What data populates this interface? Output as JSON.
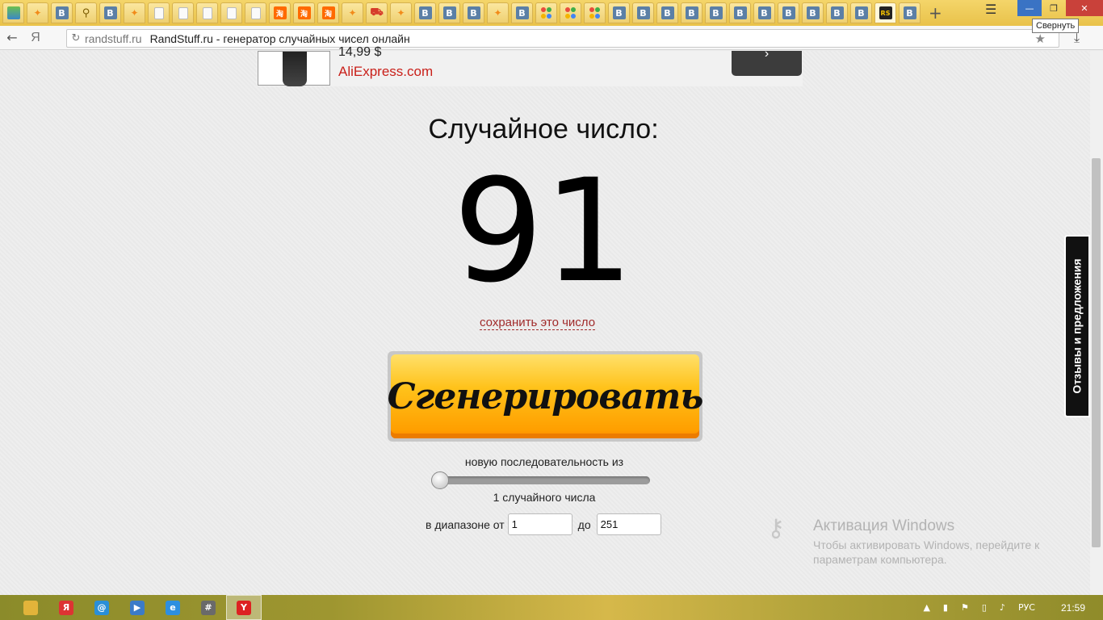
{
  "tabs": [
    {
      "icon": "image-icon",
      "type": "img"
    },
    {
      "icon": "ok-icon",
      "type": "ok"
    },
    {
      "icon": "vk-icon",
      "type": "vk",
      "glyph": "В"
    },
    {
      "icon": "search-magnifier-icon",
      "type": "search"
    },
    {
      "icon": "vk-icon",
      "type": "vk",
      "glyph": "В"
    },
    {
      "icon": "ok-icon",
      "type": "ok"
    },
    {
      "icon": "document-icon",
      "type": "doc"
    },
    {
      "icon": "document-icon",
      "type": "doc"
    },
    {
      "icon": "document-icon",
      "type": "doc"
    },
    {
      "icon": "document-icon",
      "type": "doc"
    },
    {
      "icon": "document-icon",
      "type": "doc"
    },
    {
      "icon": "taobao-icon",
      "type": "taobao"
    },
    {
      "icon": "taobao-icon",
      "type": "taobao"
    },
    {
      "icon": "taobao-icon",
      "type": "taobao"
    },
    {
      "icon": "ok-icon",
      "type": "ok"
    },
    {
      "icon": "shopping-cart-icon",
      "type": "cart"
    },
    {
      "icon": "ok-icon",
      "type": "ok"
    },
    {
      "icon": "vk-icon",
      "type": "vk",
      "glyph": "В"
    },
    {
      "icon": "vk-icon",
      "type": "vk",
      "glyph": "В"
    },
    {
      "icon": "vk-icon",
      "type": "vk",
      "glyph": "В"
    },
    {
      "icon": "ok-icon",
      "type": "ok"
    },
    {
      "icon": "vk-icon",
      "type": "vk",
      "glyph": "В"
    },
    {
      "icon": "colored-dots-icon",
      "type": "dots"
    },
    {
      "icon": "colored-dots-icon",
      "type": "dots"
    },
    {
      "icon": "colored-dots-icon",
      "type": "dots"
    },
    {
      "icon": "vk-icon",
      "type": "vk",
      "glyph": "В"
    },
    {
      "icon": "vk-icon",
      "type": "vk",
      "glyph": "В"
    },
    {
      "icon": "vk-icon",
      "type": "vk",
      "glyph": "В"
    },
    {
      "icon": "vk-icon",
      "type": "vk",
      "glyph": "В"
    },
    {
      "icon": "vk-icon",
      "type": "vk",
      "glyph": "В"
    },
    {
      "icon": "vk-icon",
      "type": "vk",
      "glyph": "В"
    },
    {
      "icon": "vk-icon",
      "type": "vk",
      "glyph": "В"
    },
    {
      "icon": "vk-icon",
      "type": "vk",
      "glyph": "В"
    },
    {
      "icon": "vk-icon",
      "type": "vk",
      "glyph": "В"
    },
    {
      "icon": "vk-icon",
      "type": "vk",
      "glyph": "В"
    },
    {
      "icon": "vk-icon",
      "type": "vk",
      "glyph": "В"
    },
    {
      "icon": "randstuff-icon",
      "type": "rs",
      "glyph": "RS",
      "active": true
    },
    {
      "icon": "vk-icon",
      "type": "vk",
      "glyph": "В"
    }
  ],
  "window": {
    "tooltip": "Свернуть"
  },
  "address": {
    "domain": "randstuff.ru",
    "title": "RandStuff.ru - генератор случайных чисел онлайн",
    "yandex_glyph": "Я"
  },
  "ad": {
    "price": "14,99 $",
    "link": "AliExpress.com",
    "button_glyph": "›"
  },
  "main": {
    "heading": "Случайное число:",
    "number": "91",
    "save_link": "сохранить это число",
    "generate_button": "Сгенерировать",
    "sequence_label": "новую последовательность из",
    "count_label": "1 случайного числа",
    "range_from_label": "в диапазоне от",
    "range_from_value": "1",
    "range_to_label": "до",
    "range_to_value": "251",
    "slider_value": 1
  },
  "feedback_tab": "Отзывы и предложения",
  "activation": {
    "title": "Активация Windows",
    "line1": "Чтобы активировать Windows, перейдите к",
    "line2": "параметрам компьютера."
  },
  "taskbar": {
    "apps": [
      {
        "icon": "file-explorer-icon",
        "color": "#e2b43a",
        "glyph": ""
      },
      {
        "icon": "yandex-browser-icon",
        "color": "#d33",
        "glyph": "Я"
      },
      {
        "icon": "mail-icon",
        "color": "#2a8fd8",
        "glyph": "@"
      },
      {
        "icon": "media-player-icon",
        "color": "#3b7bc8",
        "glyph": "▶"
      },
      {
        "icon": "internet-explorer-icon",
        "color": "#2d8fe0",
        "glyph": "e"
      },
      {
        "icon": "calculator-icon",
        "color": "#6a6a6a",
        "glyph": "#"
      },
      {
        "icon": "yandex-active-icon",
        "color": "#d22",
        "glyph": "Y",
        "active": true
      }
    ],
    "language": "РУС",
    "clock": "21:59"
  },
  "colors": {
    "accent_button": "#ffb300",
    "link": "#a12b2b",
    "ad_link": "#c9201a"
  }
}
